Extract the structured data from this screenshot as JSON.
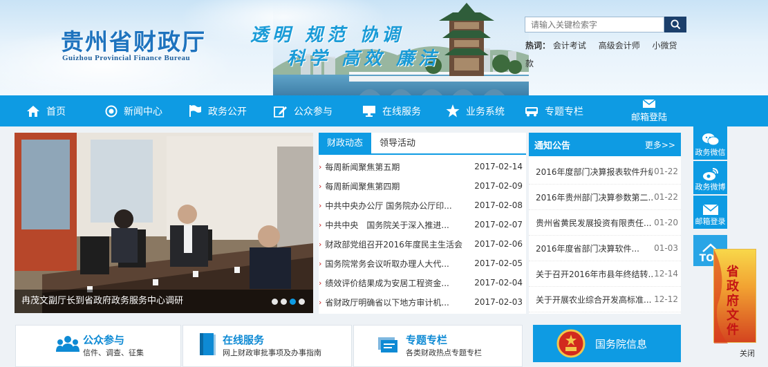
{
  "header": {
    "site_name_cn": "贵州省财政厅",
    "site_name_en": "Guizhou Provincial Finance Bureau",
    "slogan_line1": "透明 规范 协调",
    "slogan_line2": "科学 高效 廉洁",
    "search_placeholder": "请输入关键检索字",
    "hot_label": "热词：",
    "hot_keywords": [
      "会计考试",
      "高级会计师",
      "小微贷款"
    ]
  },
  "nav": {
    "items": [
      {
        "label": "首页",
        "icon": "home-icon"
      },
      {
        "label": "新闻中心",
        "icon": "target-icon"
      },
      {
        "label": "政务公开",
        "icon": "flag-icon"
      },
      {
        "label": "公众参与",
        "icon": "edit-icon"
      },
      {
        "label": "在线服务",
        "icon": "monitor-icon"
      },
      {
        "label": "业务系统",
        "icon": "star-icon"
      },
      {
        "label": "专题专栏",
        "icon": "bus-icon"
      }
    ],
    "mail_label": "邮箱登陆"
  },
  "slider": {
    "caption": "冉茂文副厅长到省政府政务服务中心调研",
    "dots": 4,
    "active_dot": 3
  },
  "news": {
    "tabs": [
      "财政动态",
      "领导活动"
    ],
    "active_tab": 0,
    "items": [
      {
        "title": "每周新闻聚焦第五期",
        "date": "2017-02-14"
      },
      {
        "title": "每周新闻聚焦第四期",
        "date": "2017-02-09"
      },
      {
        "title": "中共中央办公厅 国务院办公厅印...",
        "date": "2017-02-08"
      },
      {
        "title": "中共中央　国务院关于深入推进...",
        "date": "2017-02-07"
      },
      {
        "title": "财政部党组召开2016年度民主生活会",
        "date": "2017-02-06"
      },
      {
        "title": "国务院常务会议听取办理人大代...",
        "date": "2017-02-05"
      },
      {
        "title": "绩效评价结果成为安居工程资金...",
        "date": "2017-02-04"
      },
      {
        "title": "省财政厅明确省以下地方审计机...",
        "date": "2017-02-03"
      }
    ]
  },
  "notice": {
    "title": "通知公告",
    "more": "更多>>",
    "items": [
      {
        "title": "2016年度部门决算报表软件升级",
        "date": "01-22"
      },
      {
        "title": "2016年贵州部门决算参数第二...",
        "date": "01-22"
      },
      {
        "title": "贵州省黄民发展投资有限责任...",
        "date": "01-20"
      },
      {
        "title": "2016年度省部门决算软件...",
        "date": "01-03"
      },
      {
        "title": "关于召开2016年市县年终结转...",
        "date": "12-14"
      },
      {
        "title": "关于开展农业综合开发高标准...",
        "date": "12-12"
      }
    ]
  },
  "side": {
    "weixin": "政务微信",
    "weibo": "政务微博",
    "mail": "邮箱登录",
    "top": "TOP"
  },
  "float_ad": {
    "text": "省政府文件",
    "close": "关闭"
  },
  "bottom": {
    "public": {
      "title": "公众参与",
      "sub": "信件、调查、征集"
    },
    "service": {
      "title": "在线服务",
      "sub": "网上财政审批事项及办事指南"
    },
    "special": {
      "title": "专题专栏",
      "sub": "各类财政热点专题专栏"
    },
    "gov": {
      "title": "国务院信息"
    }
  },
  "colors": {
    "accent": "#0e9be3",
    "search_button": "#1b3f6b",
    "arrow": "#c81e1e"
  }
}
